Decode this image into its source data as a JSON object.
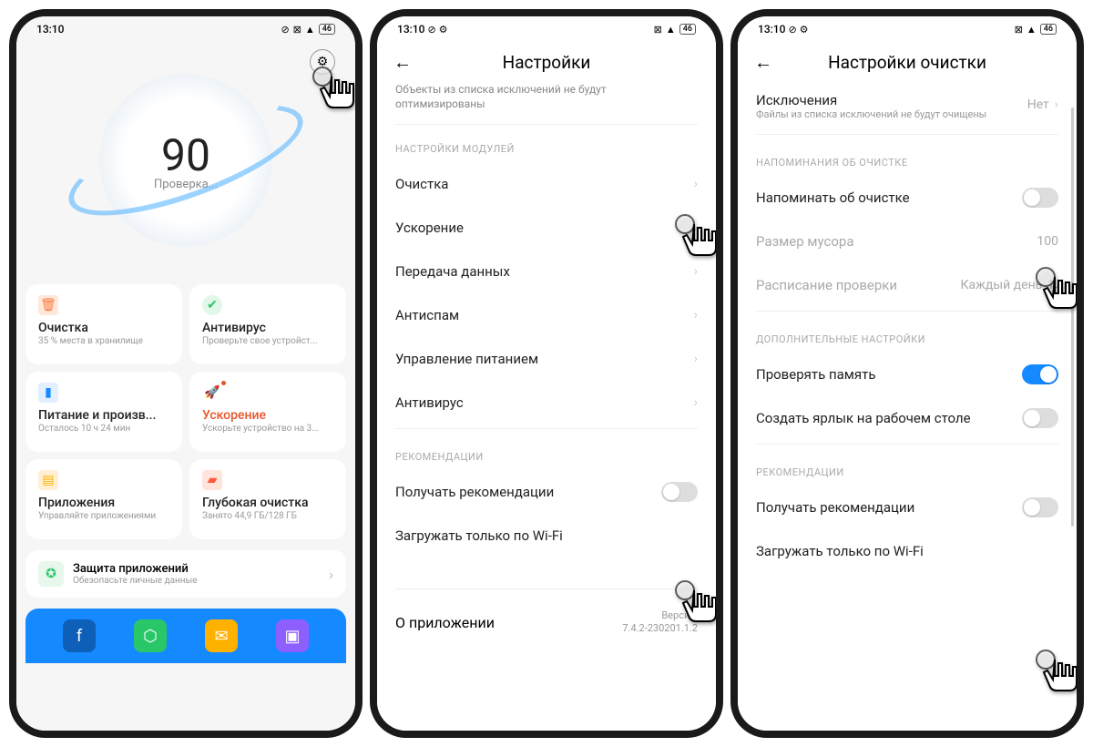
{
  "status": {
    "time": "13:10",
    "battery": "46"
  },
  "phone1": {
    "score": "90",
    "score_label": "Проверка...",
    "tiles": [
      {
        "title": "Очистка",
        "sub": "35 % места в хранилище",
        "color": "#ff7a3d"
      },
      {
        "title": "Антивирус",
        "sub": "Проверьте свое устройст...",
        "color": "#2ac769"
      },
      {
        "title": "Питание и произв...",
        "sub": "Осталось 10 ч 24 мин",
        "color": "#1589ff"
      },
      {
        "title": "Ускорение",
        "sub": "Ускорьте устройство на 3...",
        "color": "#1589ff",
        "red": true,
        "dot": true
      },
      {
        "title": "Приложения",
        "sub": "Управляйте приложениями",
        "color": "#ffb100"
      },
      {
        "title": "Глубокая очистка",
        "sub": "Занято 44,9 ГБ/128 ГБ",
        "color": "#ff5a3d"
      }
    ],
    "banner": {
      "title": "Защита приложений",
      "sub": "Обезопасьте личные данные"
    }
  },
  "phone2": {
    "title": "Настройки",
    "truncated": "Объекты из списка исключений не будут оптимизированы",
    "section_modules": "НАСТРОЙКИ МОДУЛЕЙ",
    "modules": [
      "Очистка",
      "Ускорение",
      "Передача данных",
      "Антиспам",
      "Управление питанием",
      "Антивирус"
    ],
    "section_recs": "РЕКОМЕНДАЦИИ",
    "rec1": "Получать рекомендации",
    "rec2": "Загружать только по Wi-Fi",
    "about": "О приложении",
    "version_label": "Версия:",
    "version": "7.4.2-230201.1.2"
  },
  "phone3": {
    "title": "Настройки очистки",
    "excl_title": "Исключения",
    "excl_sub": "Файлы из списка исключений не будут очищены",
    "excl_val": "Нет",
    "section_remind": "НАПОМИНАНИЯ ОБ ОЧИСТКЕ",
    "remind": "Напоминать об очистке",
    "trash_size": "Размер мусора",
    "trash_val": "100",
    "schedule": "Расписание проверки",
    "schedule_val": "Каждый день",
    "section_extra": "ДОПОЛНИТЕЛЬНЫЕ НАСТРОЙКИ",
    "check_mem": "Проверять память",
    "shortcut": "Создать ярлык на рабочем столе",
    "section_recs": "РЕКОМЕНДАЦИИ",
    "rec1": "Получать рекомендации",
    "rec2": "Загружать только по Wi-Fi"
  }
}
